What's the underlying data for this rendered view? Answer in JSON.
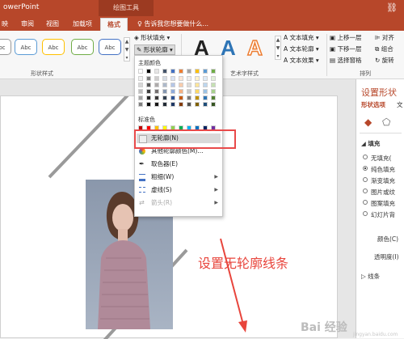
{
  "titlebar": {
    "app_title": "owerPoint",
    "context_tab_title": "绘图工具",
    "link_symbol": "⛓"
  },
  "tabs": [
    {
      "label": "映"
    },
    {
      "label": "审阅"
    },
    {
      "label": "视图"
    },
    {
      "label": "加载项"
    },
    {
      "label": "格式",
      "active": true
    }
  ],
  "tellme": "♀ 告诉我您想要做什么...",
  "ribbon": {
    "style_preset_label": "Abc",
    "preset_border_colors": [
      "#999999",
      "#5b9bd5",
      "#ed7d31",
      "#a5a5a5",
      "#ffc000",
      "#4472c4",
      "#70ad47"
    ],
    "shape_fill": "形状填充",
    "shape_outline": "形状轮廓",
    "shape_effects": "形状效果",
    "shape_styles_group": "形状样式",
    "wordart_letter": "A",
    "wordart_colors": [
      "#222222",
      "#2e75b6",
      "#ed7d31"
    ],
    "text_fill": "文本填充",
    "text_outline": "文本轮廓",
    "text_effects": "文本效果",
    "wordart_group": "艺术字样式",
    "bring_forward": "上移一层",
    "send_backward": "下移一层",
    "selection_pane": "选择窗格",
    "align": "对齐",
    "group": "组合",
    "rotate": "旋转",
    "arrange_group": "排列"
  },
  "dropdown": {
    "theme_colors_header": "主题颜色",
    "theme_colors": [
      [
        "#ffffff",
        "#000000",
        "#e7e6e6",
        "#44546a",
        "#4472c4",
        "#ed7d31",
        "#a5a5a5",
        "#ffc000",
        "#5b9bd5",
        "#70ad47"
      ],
      [
        "#f2f2f2",
        "#7f7f7f",
        "#d0cece",
        "#d6dce4",
        "#d9e2f3",
        "#fbe5d5",
        "#ededed",
        "#fff2cc",
        "#deebf6",
        "#e2efd9"
      ],
      [
        "#d8d8d8",
        "#595959",
        "#aeabab",
        "#adb9ca",
        "#b4c6e7",
        "#f7cbac",
        "#dbdbdb",
        "#fee599",
        "#bdd7ee",
        "#c5e0b3"
      ],
      [
        "#bfbfbf",
        "#3f3f3f",
        "#757070",
        "#8496b0",
        "#8eaadb",
        "#f4b183",
        "#c9c9c9",
        "#ffd965",
        "#9cc3e5",
        "#a8d08d"
      ],
      [
        "#a5a5a5",
        "#262626",
        "#3a3838",
        "#323f4f",
        "#2f5496",
        "#c55a11",
        "#7b7b7b",
        "#bf9000",
        "#2e75b5",
        "#538135"
      ],
      [
        "#7f7f7f",
        "#0c0c0c",
        "#171616",
        "#222a35",
        "#1f3864",
        "#833c0b",
        "#525252",
        "#7f6000",
        "#1e4e79",
        "#375623"
      ]
    ],
    "standard_colors_header": "标准色",
    "standard_colors": [
      "#c00000",
      "#ff0000",
      "#ffc000",
      "#ffff00",
      "#92d050",
      "#00b050",
      "#00b0f0",
      "#0070c0",
      "#002060",
      "#7030a0"
    ],
    "items": [
      {
        "label": "无轮廓(N)",
        "highlighted": true
      },
      {
        "label": "其他轮廓颜色(M)..."
      },
      {
        "label": "取色器(E)"
      },
      {
        "label": "粗细(W)",
        "arrow": "▶"
      },
      {
        "label": "虚线(S)",
        "arrow": "▶"
      },
      {
        "label": "箭头(R)",
        "arrow": "▶",
        "disabled": true
      }
    ]
  },
  "pane": {
    "title": "设置形状",
    "tab1": "形状选项",
    "tab2": "文",
    "fill_header": "填充",
    "fill_options": [
      {
        "label": "无填充(",
        "selected": false
      },
      {
        "label": "纯色填充",
        "selected": true
      },
      {
        "label": "渐变填充",
        "selected": false
      },
      {
        "label": "图片或纹",
        "selected": false
      },
      {
        "label": "图案填充",
        "selected": false
      },
      {
        "label": "幻灯片背",
        "selected": false
      }
    ],
    "color_label": "颜色(C)",
    "transparency_label": "透明度(I)",
    "line_header": "线条"
  },
  "annotation": "设置无轮廓线条",
  "watermark": "Bai 经验",
  "watermark_sub": "jingyan.baidu.com"
}
